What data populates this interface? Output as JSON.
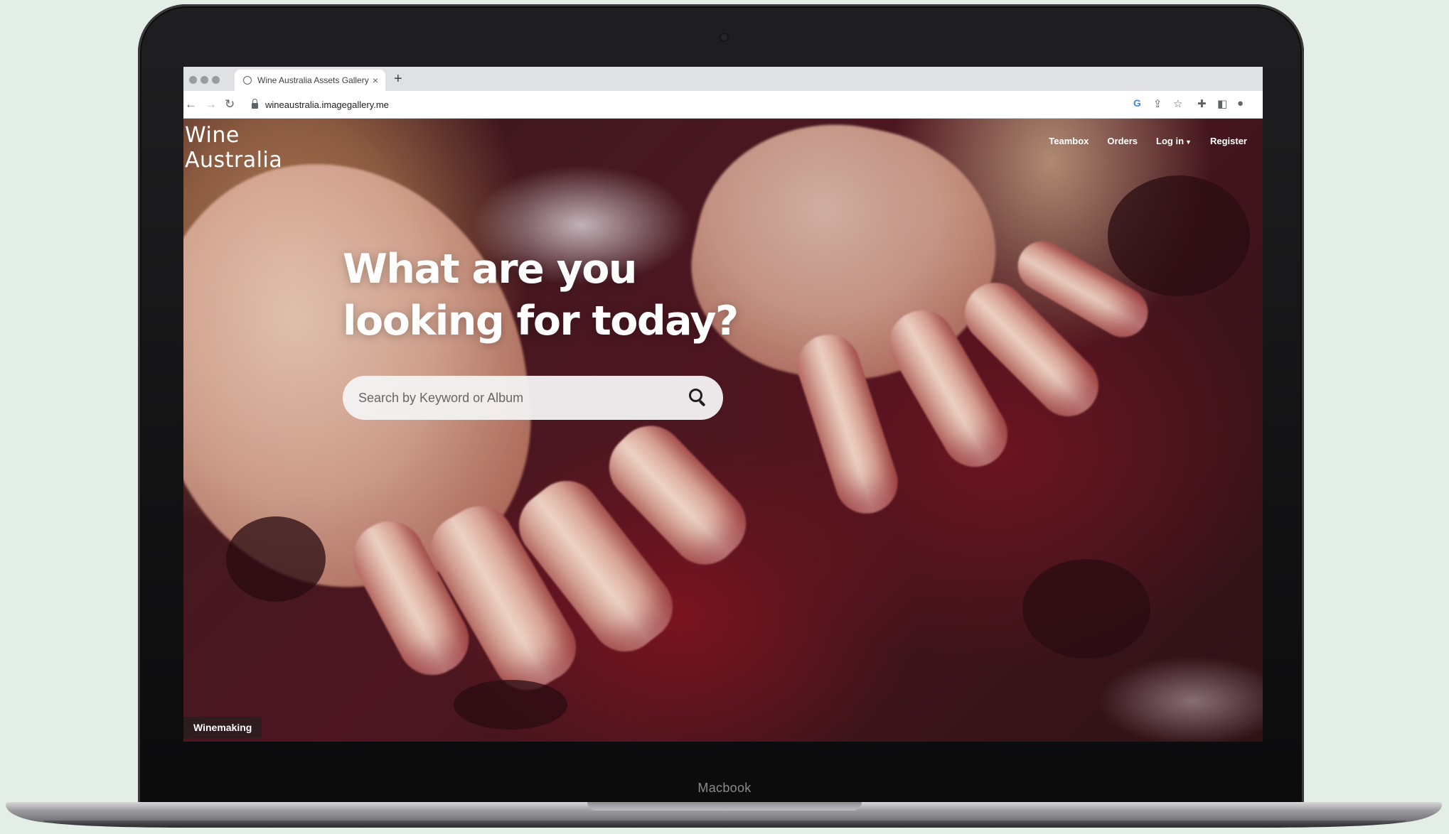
{
  "device": {
    "label": "Macbook"
  },
  "browser": {
    "tab_title": "Wine Australia Assets Gallery",
    "tab_close": "×",
    "new_tab": "+",
    "url": "wineaustralia.imagegallery.me",
    "back_icon": "arrow-left-icon",
    "forward_icon": "arrow-right-icon",
    "reload_icon": "reload-icon",
    "toolbar_icons": [
      "google-icon",
      "share-icon",
      "star-icon",
      "extensions-icon",
      "sidebar-icon",
      "profile-icon"
    ]
  },
  "site": {
    "logo_line1": "Wine",
    "logo_line2": "Australia",
    "nav": {
      "teambox": "Teambox",
      "orders": "Orders",
      "login": "Log in",
      "register": "Register"
    },
    "hero": {
      "line1": "What are you",
      "line2": "looking for today?"
    },
    "search": {
      "placeholder": "Search by Keyword or Album",
      "value": ""
    },
    "caption": "Winemaking",
    "help_symbol": "?"
  },
  "colors": {
    "help_button": "#1f7cc0",
    "notification_dot": "#e03b3b",
    "background": "#e2eee6"
  }
}
